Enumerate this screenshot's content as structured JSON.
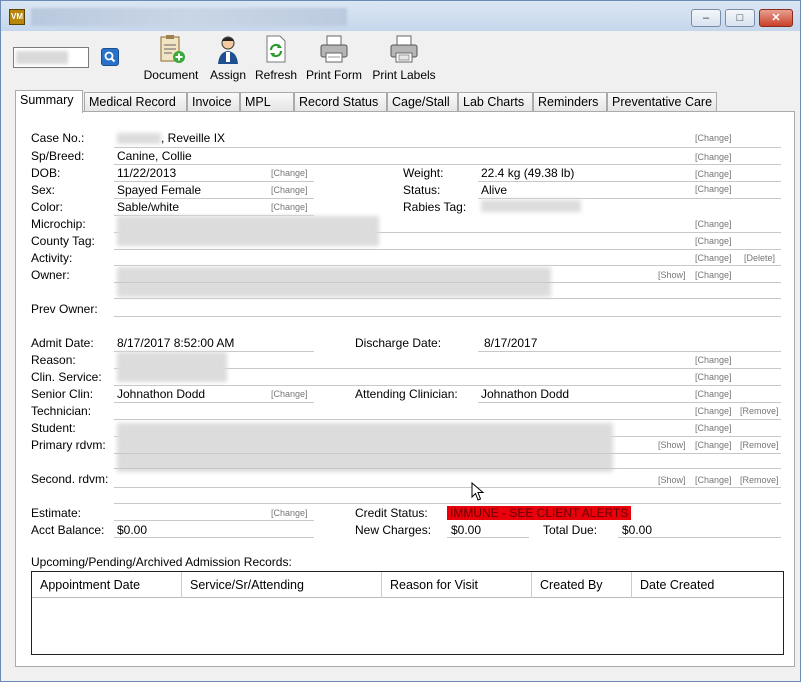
{
  "window": {
    "min_symbol": "–",
    "max_symbol": "□",
    "close_symbol": "✕"
  },
  "toolbar": {
    "buttons": [
      {
        "label": "Document",
        "icon": "clipboard-add-icon"
      },
      {
        "label": "Assign",
        "icon": "person-icon"
      },
      {
        "label": "Refresh",
        "icon": "refresh-icon"
      },
      {
        "label": "Print Form",
        "icon": "printer-icon"
      },
      {
        "label": "Print Labels",
        "icon": "printer-labels-icon"
      }
    ]
  },
  "tabs": [
    {
      "label": "Summary",
      "active": true
    },
    {
      "label": "Medical Record"
    },
    {
      "label": "Invoice"
    },
    {
      "label": "MPL"
    },
    {
      "label": "Record Status"
    },
    {
      "label": "Cage/Stall"
    },
    {
      "label": "Lab Charts"
    },
    {
      "label": "Reminders"
    },
    {
      "label": "Preventative Care"
    }
  ],
  "links": {
    "change": "[Change]",
    "delete": "[Delete]",
    "show": "[Show]",
    "remove": "[Remove]"
  },
  "summary": {
    "case_no_label": "Case No.:",
    "case_no_value": ", Reveille IX",
    "species_label": "Sp/Breed:",
    "species_value": "Canine, Collie",
    "dob_label": "DOB:",
    "dob_value": "11/22/2013",
    "weight_label": "Weight:",
    "weight_value": "22.4 kg (49.38 lb)",
    "sex_label": "Sex:",
    "sex_value": "Spayed Female",
    "status_label": "Status:",
    "status_value": "Alive",
    "color_label": "Color:",
    "color_value": "Sable/white",
    "rabies_label": "Rabies Tag:",
    "microchip_label": "Microchip:",
    "county_tag_label": "County Tag:",
    "activity_label": "Activity:",
    "owner_label": "Owner:",
    "prev_owner_label": "Prev Owner:",
    "admit_date_label": "Admit Date:",
    "admit_date_value": "8/17/2017 8:52:00 AM",
    "discharge_date_label": "Discharge Date:",
    "discharge_date_value": "8/17/2017",
    "reason_label": "Reason:",
    "clin_service_label": "Clin. Service:",
    "senior_clin_label": "Senior Clin:",
    "senior_clin_value": "Johnathon Dodd",
    "attending_label": "Attending Clinician:",
    "attending_value": "Johnathon Dodd",
    "technician_label": "Technician:",
    "student_label": "Student:",
    "primary_rdvm_label": "Primary rdvm:",
    "second_rdvm_label": "Second. rdvm:",
    "estimate_label": "Estimate:",
    "credit_status_label": "Credit Status:",
    "credit_status_value": "IMMUNE - SEE CLIENT ALERTS",
    "acct_balance_label": "Acct Balance:",
    "acct_balance_value": "$0.00",
    "new_charges_label": "New Charges:",
    "new_charges_value": "$0.00",
    "total_due_label": "Total Due:",
    "total_due_value": "$0.00"
  },
  "admissions": {
    "title": "Upcoming/Pending/Archived Admission Records:",
    "columns": [
      "Appointment Date",
      "Service/Sr/Attending",
      "Reason for Visit",
      "Created By",
      "Date Created"
    ],
    "rows": []
  },
  "colors": {
    "alert_bg": "#e8000b",
    "link": "#777777"
  }
}
